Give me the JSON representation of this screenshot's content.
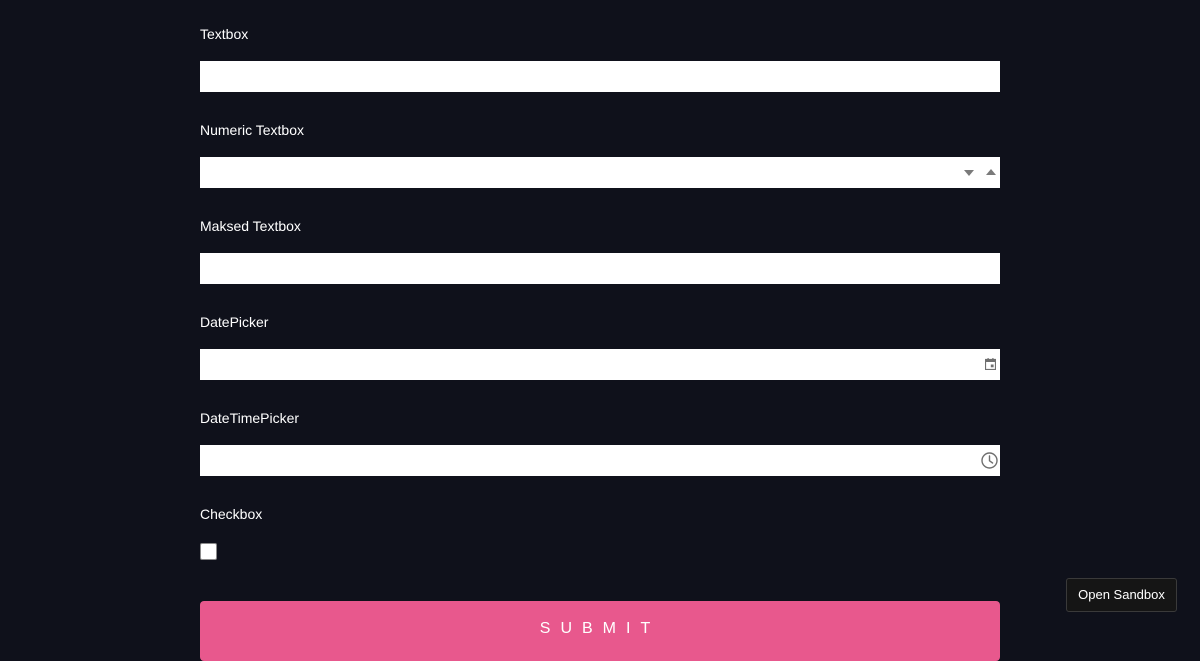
{
  "form": {
    "fields": [
      {
        "label": "Textbox",
        "value": "",
        "placeholder": ""
      },
      {
        "label": "Numeric Textbox",
        "value": "",
        "placeholder": ""
      },
      {
        "label": "Maksed Textbox",
        "value": "",
        "placeholder": ""
      },
      {
        "label": "DatePicker",
        "value": "",
        "placeholder": ""
      },
      {
        "label": "DateTimePicker",
        "value": "",
        "placeholder": ""
      }
    ],
    "checkbox": {
      "label": "Checkbox",
      "checked": false
    },
    "submit_label": "SUBMIT"
  },
  "sandbox": {
    "label": "Open Sandbox"
  },
  "colors": {
    "background": "#0f111b",
    "accent": "#e8588d",
    "field_bg": "#ffffff"
  },
  "icons": [
    "chevron-down-icon",
    "chevron-up-icon",
    "calendar-icon",
    "clock-icon"
  ]
}
